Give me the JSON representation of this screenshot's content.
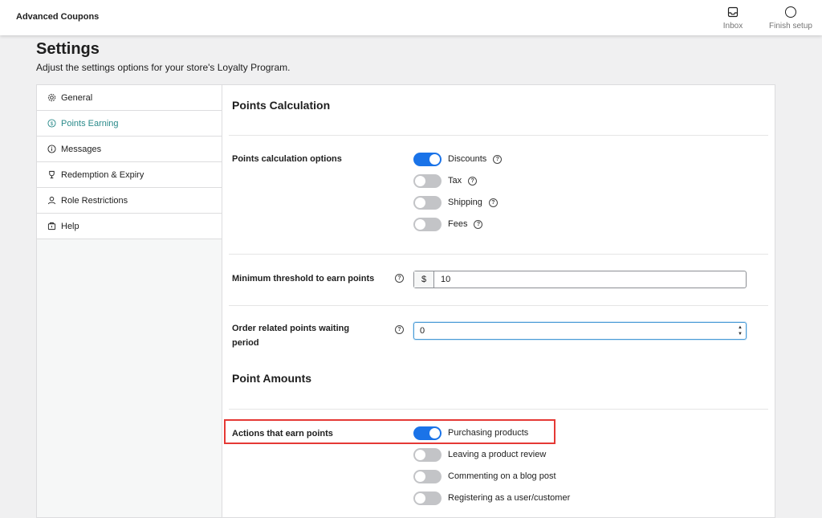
{
  "topbar": {
    "brand": "Advanced Coupons",
    "inbox_label": "Inbox",
    "finish_label": "Finish setup"
  },
  "page": {
    "title": "Settings",
    "subtitle": "Adjust the settings options for your store's Loyalty Program."
  },
  "sidebar": {
    "items": [
      {
        "label": "General",
        "icon": "gear-icon"
      },
      {
        "label": "Points Earning",
        "icon": "dollar-circle-icon"
      },
      {
        "label": "Messages",
        "icon": "info-icon"
      },
      {
        "label": "Redemption & Expiry",
        "icon": "trophy-icon"
      },
      {
        "label": "Role Restrictions",
        "icon": "user-icon"
      },
      {
        "label": "Help",
        "icon": "help-box-icon"
      }
    ]
  },
  "points_calc": {
    "title": "Points Calculation",
    "options_label": "Points calculation options",
    "options": [
      {
        "label": "Discounts",
        "on": true
      },
      {
        "label": "Tax",
        "on": false
      },
      {
        "label": "Shipping",
        "on": false
      },
      {
        "label": "Fees",
        "on": false
      }
    ],
    "threshold_label": "Minimum threshold to earn points",
    "threshold_prefix": "$",
    "threshold_value": "10",
    "waiting_label_1": "Order related points waiting",
    "waiting_label_2": "period",
    "waiting_value": "0"
  },
  "point_amounts": {
    "title": "Point Amounts",
    "actions_label": "Actions that earn points",
    "actions": [
      {
        "label": "Purchasing products",
        "on": true
      },
      {
        "label": "Leaving a product review",
        "on": false
      },
      {
        "label": "Commenting on a blog post",
        "on": false
      },
      {
        "label": "Registering as a user/customer",
        "on": false
      }
    ]
  },
  "colors": {
    "accent": "#1a73e8",
    "active_nav": "#2a8a8a",
    "highlight": "#e53935"
  }
}
